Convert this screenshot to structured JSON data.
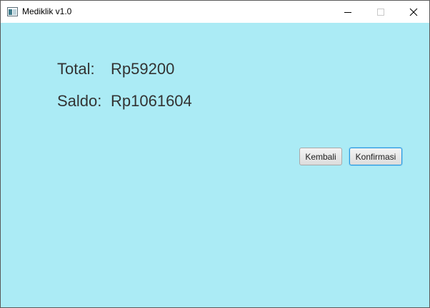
{
  "window": {
    "title": "Mediklik v1.0"
  },
  "summary": {
    "total_label": "Total:",
    "total_value": "Rp59200",
    "saldo_label": "Saldo:",
    "saldo_value": "Rp1061604"
  },
  "actions": {
    "back_label": "Kembali",
    "confirm_label": "Konfirmasi"
  },
  "colors": {
    "background": "#abebf5",
    "focus_border": "#1e9be0"
  },
  "icons": {
    "app": "app-window-icon",
    "minimize": "minimize-icon",
    "maximize": "maximize-icon",
    "close": "close-icon"
  }
}
